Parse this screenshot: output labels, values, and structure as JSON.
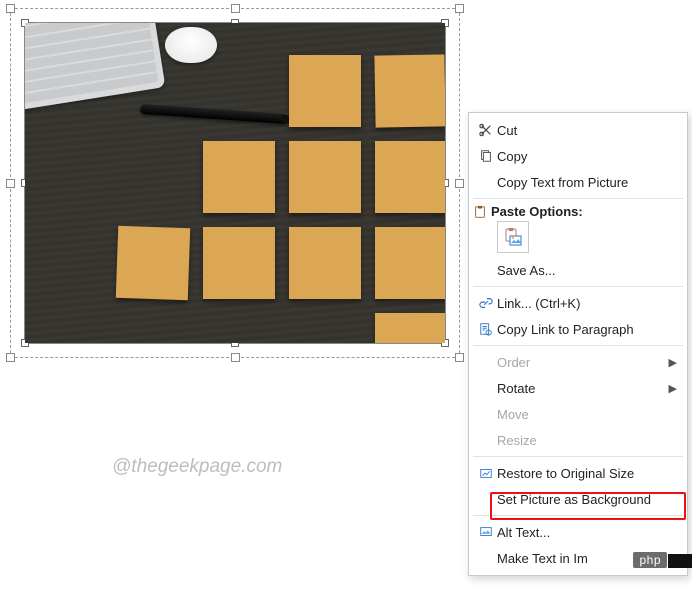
{
  "watermark": "@thegeekpage.com",
  "menu": {
    "cut": "Cut",
    "copy": "Copy",
    "copy_text_from_picture": "Copy Text from Picture",
    "paste_options_caption": "Paste Options:",
    "save_as": "Save As...",
    "link": "Link...  (Ctrl+K)",
    "copy_link_to_paragraph": "Copy Link to Paragraph",
    "order": "Order",
    "rotate": "Rotate",
    "move": "Move",
    "resize": "Resize",
    "restore_original": "Restore to Original Size",
    "set_as_background": "Set Picture as Background",
    "alt_text": "Alt Text...",
    "make_text_in_image": "Make Text in Im"
  },
  "badge": "php"
}
